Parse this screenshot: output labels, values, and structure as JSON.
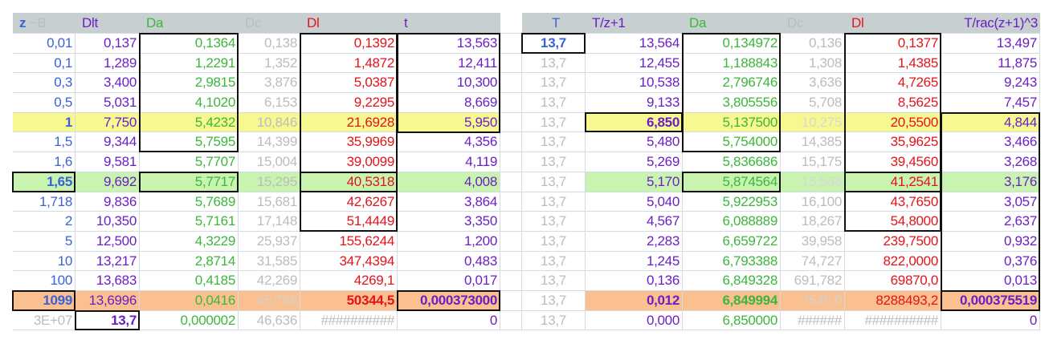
{
  "colors": {
    "z": "#3a62d8",
    "purple": "#6a1fc6",
    "green": "#3cb63c",
    "grey": "#bcbcbc",
    "red": "#e3141c",
    "header_bg": "#c8cfd1",
    "yellow": "#f8f890",
    "lightgreen": "#c8f4b0",
    "orange": "#fbc090"
  },
  "left_headers": [
    {
      "main": "z",
      "sub": " ~B"
    },
    {
      "main": "Dlt"
    },
    {
      "main": "Da"
    },
    {
      "main": "Dc"
    },
    {
      "main": "Dl"
    },
    {
      "main": "t"
    }
  ],
  "right_headers": [
    "T",
    "T/z+1",
    "Da",
    "Dc",
    "Dl",
    "T/rac(z+1)^3"
  ],
  "left_rows": [
    [
      "0,01",
      "0,137",
      "0,1364",
      "0,138",
      "0,1392",
      "13,563"
    ],
    [
      "0,1",
      "1,289",
      "1,2291",
      "1,352",
      "1,4872",
      "12,411"
    ],
    [
      "0,3",
      "3,400",
      "2,9815",
      "3,876",
      "5,0387",
      "10,300"
    ],
    [
      "0,5",
      "5,031",
      "4,1020",
      "6,153",
      "9,2295",
      "8,669"
    ],
    [
      "1",
      "7,750",
      "5,4232",
      "10,846",
      "21,6928",
      "5,950"
    ],
    [
      "1,5",
      "9,344",
      "5,7595",
      "14,399",
      "35,9969",
      "4,356"
    ],
    [
      "1,6",
      "9,581",
      "5,7707",
      "15,004",
      "39,0099",
      "4,119"
    ],
    [
      "1,65",
      "9,692",
      "5,7717",
      "15,295",
      "40,5318",
      "4,008"
    ],
    [
      "1,718",
      "9,836",
      "5,7689",
      "15,681",
      "42,6267",
      "3,864"
    ],
    [
      "2",
      "10,350",
      "5,7161",
      "17,148",
      "51,4449",
      "3,350"
    ],
    [
      "5",
      "12,500",
      "4,3229",
      "25,937",
      "155,6244",
      "1,200"
    ],
    [
      "10",
      "13,217",
      "2,8714",
      "31,585",
      "347,4394",
      "0,483"
    ],
    [
      "100",
      "13,683",
      "0,4185",
      "42,269",
      "4269,1",
      "0,017"
    ],
    [
      "1099",
      "13,6996",
      "0,0416",
      "45,768",
      "50344,5",
      "0,000373000"
    ],
    [
      "3E+07",
      "13,7",
      "0,000002",
      "46,636",
      "##########",
      "0"
    ]
  ],
  "right_rows": [
    [
      "13,7",
      "13,564",
      "0,134972",
      "0,136",
      "0,1377",
      "13,497"
    ],
    [
      "13,7",
      "12,455",
      "1,188843",
      "1,308",
      "1,4385",
      "11,875"
    ],
    [
      "13,7",
      "10,538",
      "2,796746",
      "3,636",
      "4,7265",
      "9,243"
    ],
    [
      "13,7",
      "9,133",
      "3,805556",
      "5,708",
      "8,5625",
      "7,457"
    ],
    [
      "13,7",
      "6,850",
      "5,137500",
      "10,275",
      "20,5500",
      "4,844"
    ],
    [
      "13,7",
      "5,480",
      "5,754000",
      "14,385",
      "35,9625",
      "3,466"
    ],
    [
      "13,7",
      "5,269",
      "5,836686",
      "15,175",
      "39,4560",
      "3,268"
    ],
    [
      "13,7",
      "5,170",
      "5,874564",
      "15,568",
      "41,2541",
      "3,176"
    ],
    [
      "13,7",
      "5,040",
      "5,922953",
      "16,100",
      "43,7650",
      "3,057"
    ],
    [
      "13,7",
      "4,567",
      "6,088889",
      "18,267",
      "54,8000",
      "2,637"
    ],
    [
      "13,7",
      "2,283",
      "6,659722",
      "39,958",
      "239,7500",
      "0,932"
    ],
    [
      "13,7",
      "1,245",
      "6,793388",
      "74,727",
      "822,0000",
      "0,376"
    ],
    [
      "13,7",
      "0,136",
      "6,849328",
      "691,782",
      "69870,0",
      "0,013"
    ],
    [
      "13,7",
      "0,012",
      "6,849994",
      "7535,0",
      "8288493,2",
      "0,000375519"
    ],
    [
      "13,7",
      "0,000",
      "6,850000",
      "######",
      "##########",
      "0"
    ]
  ],
  "highlight_rows": {
    "yellow": 4,
    "lightgreen": 7,
    "orange": 13
  }
}
